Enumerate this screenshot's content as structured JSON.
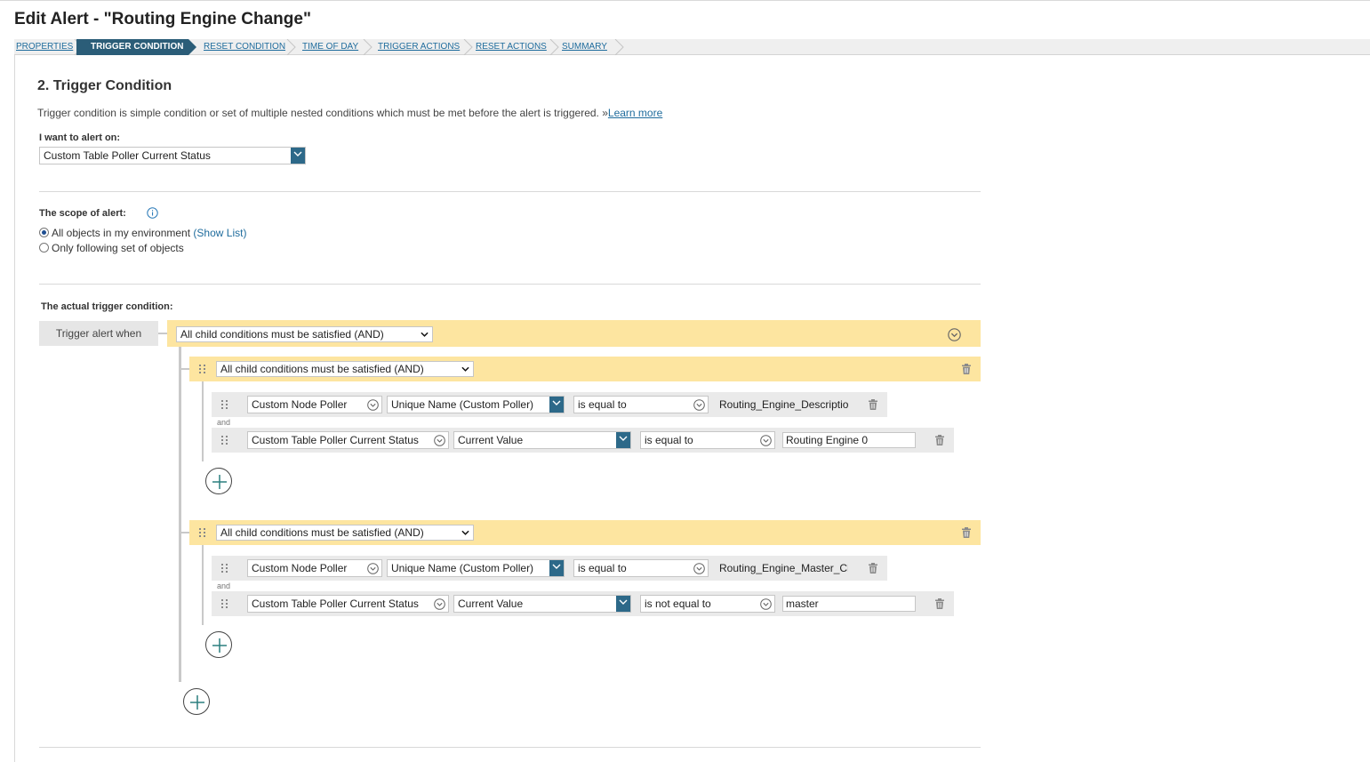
{
  "page": {
    "title": "Edit Alert - \"Routing Engine Change\""
  },
  "wizard": {
    "steps": [
      {
        "label": "PROPERTIES",
        "active": false
      },
      {
        "label": "TRIGGER CONDITION",
        "active": true
      },
      {
        "label": "RESET CONDITION",
        "active": false
      },
      {
        "label": "TIME OF DAY",
        "active": false
      },
      {
        "label": "TRIGGER ACTIONS",
        "active": false
      },
      {
        "label": "RESET ACTIONS",
        "active": false
      },
      {
        "label": "SUMMARY",
        "active": false
      }
    ]
  },
  "section": {
    "title": "2. Trigger Condition",
    "description": "Trigger condition is simple condition or set of multiple nested conditions which must be met before the alert is triggered. »",
    "learn_more": "Learn more"
  },
  "alert_on": {
    "label": "I want to alert on:",
    "value": "Custom Table Poller Current Status"
  },
  "scope": {
    "label": "The scope of alert:",
    "info_icon": "info-icon",
    "options": [
      {
        "label": "All objects in my environment",
        "link": "(Show List)",
        "checked": true
      },
      {
        "label": "Only following set of objects",
        "checked": false
      }
    ]
  },
  "trigger": {
    "label": "The actual trigger condition:",
    "when_label": "Trigger alert when",
    "root_condition": "All child conditions must be satisfied (AND)",
    "groups": [
      {
        "condition": "All child conditions must be satisfied (AND)",
        "and_label": "and",
        "rows": [
          {
            "object": "Custom Node Poller",
            "field": "Unique Name (Custom Poller)",
            "operator": "is equal to",
            "value": "Routing_Engine_Descriptio"
          },
          {
            "object": "Custom Table Poller Current Status",
            "field": "Current Value",
            "operator": "is equal to",
            "value": "Routing Engine 0"
          }
        ]
      },
      {
        "condition": "All child conditions must be satisfied (AND)",
        "and_label": "and",
        "rows": [
          {
            "object": "Custom Node Poller",
            "field": "Unique Name (Custom Poller)",
            "operator": "is equal to",
            "value": "Routing_Engine_Master_Cl"
          },
          {
            "object": "Custom Table Poller Current Status",
            "field": "Current Value",
            "operator": "is not equal to",
            "value": "master"
          }
        ]
      }
    ]
  },
  "colors": {
    "accent": "#2b5d78",
    "link": "#1f6c9d",
    "group_bg": "#fde5a0",
    "row_bg": "#eaeaea"
  }
}
